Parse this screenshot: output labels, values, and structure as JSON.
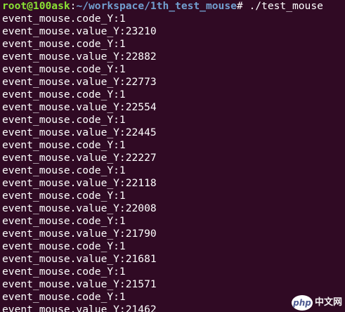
{
  "prompt": {
    "user_host": "root@100ask",
    "separator": ":",
    "path": "~/workspace/1th_test_mouse",
    "symbol": "# ",
    "command": "./test_mouse"
  },
  "output_lines": [
    "event_mouse.code_Y:1",
    "event_mouse.value_Y:23210",
    "event_mouse.code_Y:1",
    "event_mouse.value_Y:22882",
    "event_mouse.code_Y:1",
    "event_mouse.value_Y:22773",
    "event_mouse.code_Y:1",
    "event_mouse.value_Y:22554",
    "event_mouse.code_Y:1",
    "event_mouse.value_Y:22445",
    "event_mouse.code_Y:1",
    "event_mouse.value_Y:22227",
    "event_mouse.code_Y:1",
    "event_mouse.value_Y:22118",
    "event_mouse.code_Y:1",
    "event_mouse.value_Y:22008",
    "event_mouse.code_Y:1",
    "event_mouse.value_Y:21790",
    "event_mouse.code_Y:1",
    "event_mouse.value_Y:21681",
    "event_mouse.code_Y:1",
    "event_mouse.value_Y:21571",
    "event_mouse.code_Y:1",
    "event_mouse.value_Y:21462"
  ],
  "watermark": {
    "badge": "php",
    "text": "中文网"
  },
  "colors": {
    "background": "#300a24",
    "user_host": "#8ae234",
    "path": "#729fcf",
    "text": "#ffffff"
  }
}
